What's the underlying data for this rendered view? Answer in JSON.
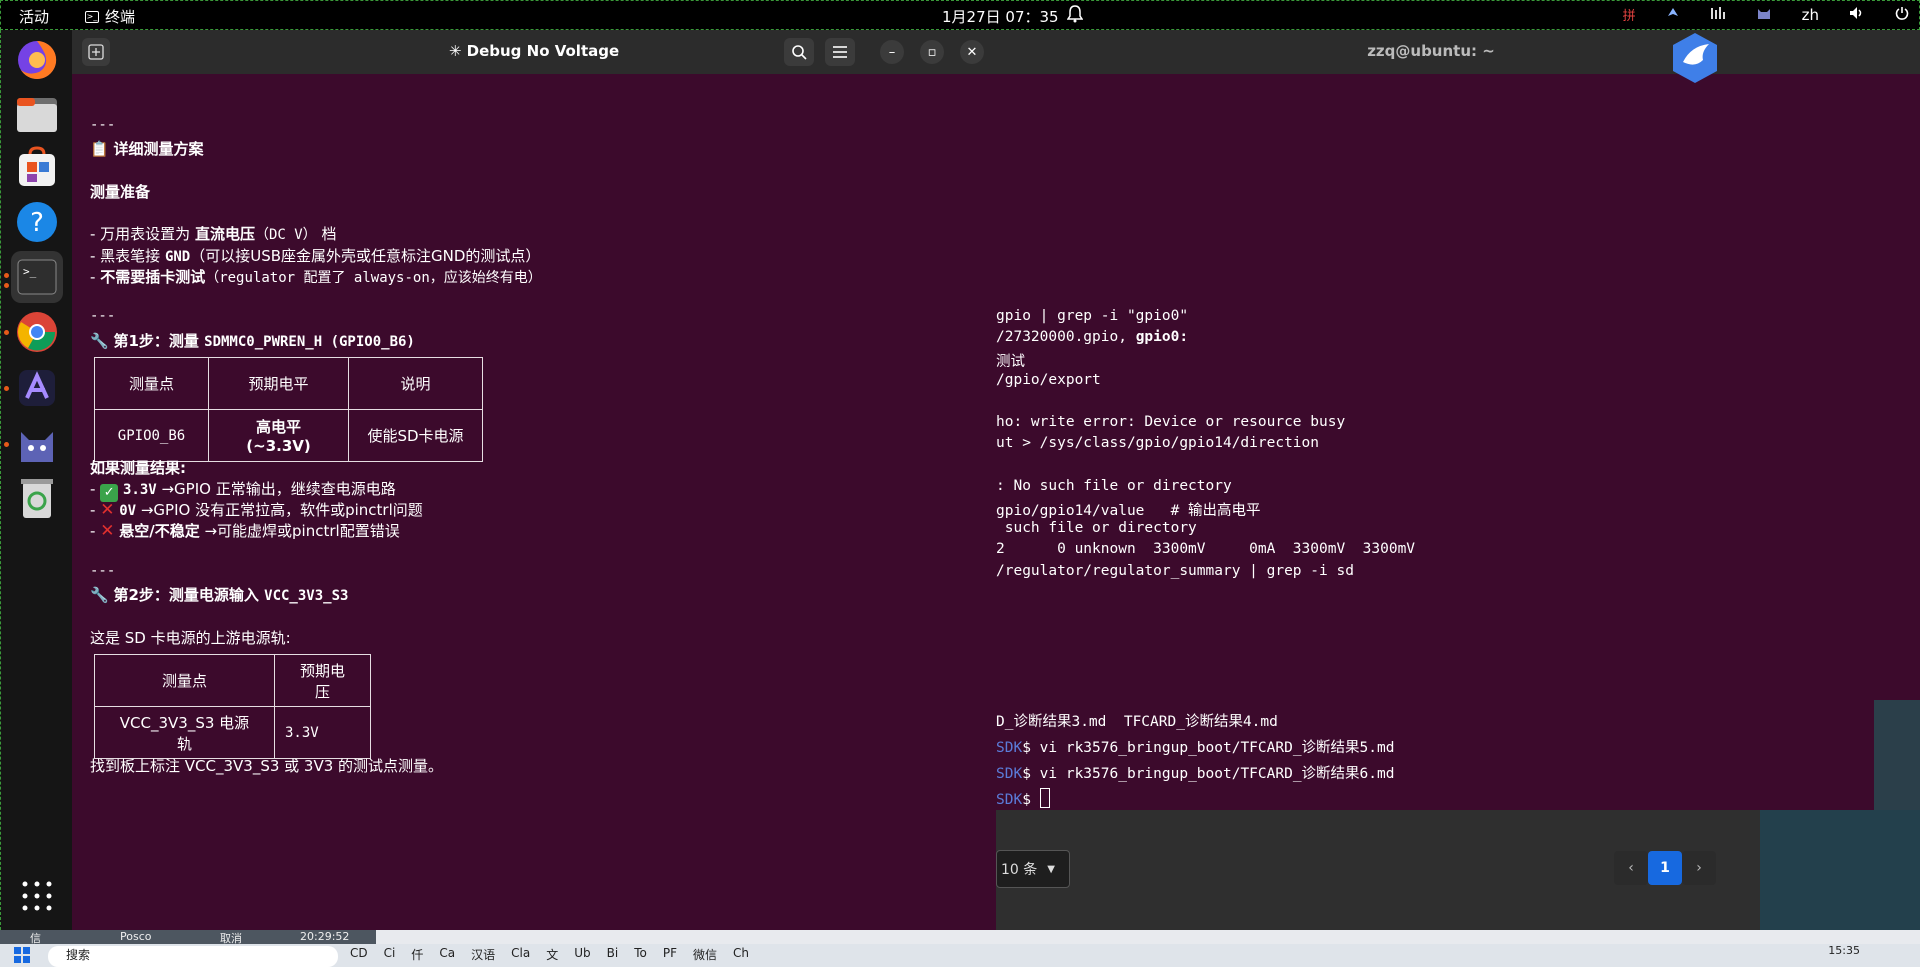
{
  "topbar": {
    "activities": "活动",
    "app_name": "终端",
    "clock": "1月27日 07：35",
    "input_method": "拼",
    "lang": "zh"
  },
  "left_window": {
    "title": "✳ Debug No Voltage",
    "content": {
      "hr1": "---",
      "section_title": "详细测量方案",
      "prep_heading": "测量准备",
      "prep_items": [
        {
          "prefix": "- 万用表设置为 ",
          "bold": "直流电压",
          "mono": "（DC V）",
          "suffix": " 档"
        },
        {
          "prefix": "- 黑表笔接 ",
          "bold": "GND",
          "mono": "",
          "suffix": "（可以接USB座金属外壳或任意标注GND的测试点）"
        },
        {
          "prefix": "- ",
          "bold": "不需要插卡测试",
          "mono": "",
          "suffix": "（regulator 配置了 always-on，应该始终有电）"
        }
      ],
      "hr2": "---",
      "step1_title": "第1步：测量 ",
      "step1_code": "SDMMC0_PWREN_H (GPIO0_B6)",
      "table1": {
        "headers": [
          "测量点",
          "预期电平",
          "说明"
        ],
        "row": [
          "GPIO0_B6",
          "高电平 (~3.3V)",
          "使能SD卡电源"
        ]
      },
      "result_heading": "如果测量结果:",
      "results": [
        {
          "mark": "✅",
          "bold": "3.3V",
          "text": " →GPIO 正常输出，继续查电源电路"
        },
        {
          "mark": "❌",
          "bold": "0V",
          "text": " →GPIO 没有正常拉高，软件或pinctrl问题"
        },
        {
          "mark": "❌",
          "bold": "悬空/不稳定",
          "text": " →可能虚焊或pinctrl配置错误"
        }
      ],
      "hr3": "---",
      "step2_title": "第2步：测量电源输入 ",
      "step2_code": "VCC_3V3_S3",
      "step2_desc": "这是 SD 卡电源的上游电源轨:",
      "table2": {
        "headers": [
          "测量点",
          "预期电压"
        ],
        "row": [
          "VCC_3V3_S3 电源轨",
          "3.3V"
        ]
      },
      "footer_line": "找到板上标注 VCC_3V3_S3 或 3V3 的测试点测量。"
    }
  },
  "right_window": {
    "title": "zzq@ubuntu: ~",
    "lines": [
      {
        "text": "gpio | grep -i \"gpio0\""
      },
      {
        "text": "/27320000.gpio, ",
        "bold": "gpio0:"
      },
      {
        "text": "测试"
      },
      {
        "text": "/gpio/export"
      },
      {
        "text": ""
      },
      {
        "text": "ho: write error: Device or resource busy"
      },
      {
        "text": "ut > /sys/class/gpio/gpio14/direction"
      },
      {
        "text": ""
      },
      {
        "text": ": No such file or directory"
      },
      {
        "text": "gpio/gpio14/value   # 输出高电平"
      },
      {
        "text": " such file or directory"
      },
      {
        "text": "2      0 unknown  3300mV     0mA  3300mV  3300mV"
      },
      {
        "text": "/regulator/regulator_summary | grep -i sd"
      }
    ]
  },
  "right_terminal2": {
    "line1": "D_诊断结果3.md  TFCARD_诊断结果4.md",
    "line2_prompt": "SDK",
    "line2_cmd": "$ vi rk3576_bringup_boot/TFCARD_诊断结果5.md",
    "line3_prompt": "SDK",
    "line3_cmd": "$ vi rk3576_bringup_boot/TFCARD_诊断结果6.md",
    "line4_prompt": "SDK",
    "line4_cmd": "$ "
  },
  "web": {
    "page_size": "10 条",
    "page_current": "1",
    "prev": "‹",
    "next": "›"
  },
  "taskbar": {
    "search_placeholder": "搜索",
    "status_items": [
      "信",
      "Posco",
      "取消",
      "20:29:52"
    ],
    "apps": [
      "CD",
      "Ci",
      "仟",
      "Ca",
      "汉语",
      "Cla",
      "文",
      "Ub",
      "Bi",
      "To",
      "PF",
      "微信",
      "Ch"
    ],
    "time": "15:35"
  },
  "colors": {
    "terminal_bg": "#3c0a2c",
    "titlebar_bg": "#2c2c2c",
    "accent_blue": "#1769e0"
  }
}
